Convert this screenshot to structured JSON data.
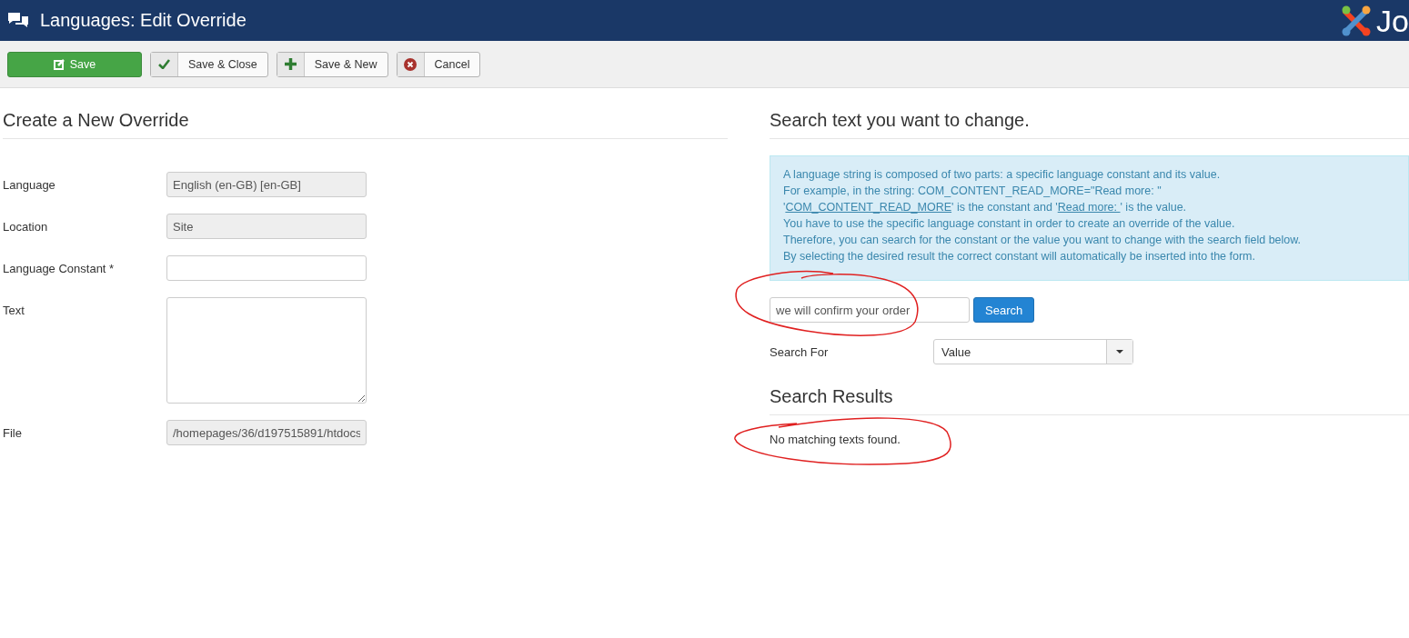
{
  "header": {
    "title": "Languages: Edit Override",
    "logo_text": "Jo"
  },
  "toolbar": [
    {
      "kind": "save",
      "label": "Save"
    },
    {
      "kind": "check",
      "label": "Save & Close"
    },
    {
      "kind": "plus",
      "label": "Save & New"
    },
    {
      "kind": "cancel",
      "label": "Cancel"
    }
  ],
  "form": {
    "heading": "Create a New Override",
    "fields": [
      {
        "label": "Language",
        "kind": "text",
        "value": "English (en-GB) [en-GB]",
        "disabled": true
      },
      {
        "label": "Location",
        "kind": "text",
        "value": "Site",
        "disabled": true
      },
      {
        "label": "Language Constant *",
        "kind": "text",
        "disabled": false
      },
      {
        "label": "Text",
        "kind": "textarea",
        "disabled": false
      },
      {
        "label": "File",
        "kind": "text",
        "value": "/homepages/36/d197515891/htdocs",
        "disabled": true
      }
    ]
  },
  "search": {
    "heading": "Search text you want to change.",
    "info_lines": [
      [
        {
          "text": "A language string is composed of two parts: a specific language constant and its value.",
          "link": false
        }
      ],
      [
        {
          "text": "For example, in the string: COM_CONTENT_READ_MORE=\"Read more: \"",
          "link": false
        }
      ],
      [
        {
          "text": "'",
          "link": false
        },
        {
          "text": "COM_CONTENT_READ_MORE",
          "link": true
        },
        {
          "text": "' is the constant and '",
          "link": false
        },
        {
          "text": "Read more: ",
          "link": true
        },
        {
          "text": "' is the value.",
          "link": false
        }
      ],
      [
        {
          "text": "You have to use the specific language constant in order to create an override of the value.",
          "link": false
        }
      ],
      [
        {
          "text": "Therefore, you can search for the constant or the value you want to change with the search field below.",
          "link": false
        }
      ],
      [
        {
          "text": "By selecting the desired result the correct constant will automatically be inserted into the form.",
          "link": false
        }
      ]
    ],
    "query": "we will confirm your order",
    "button": "Search",
    "search_for_label": "Search For",
    "search_for_value": "Value",
    "results_heading": "Search Results",
    "results_message": "No matching texts found."
  }
}
